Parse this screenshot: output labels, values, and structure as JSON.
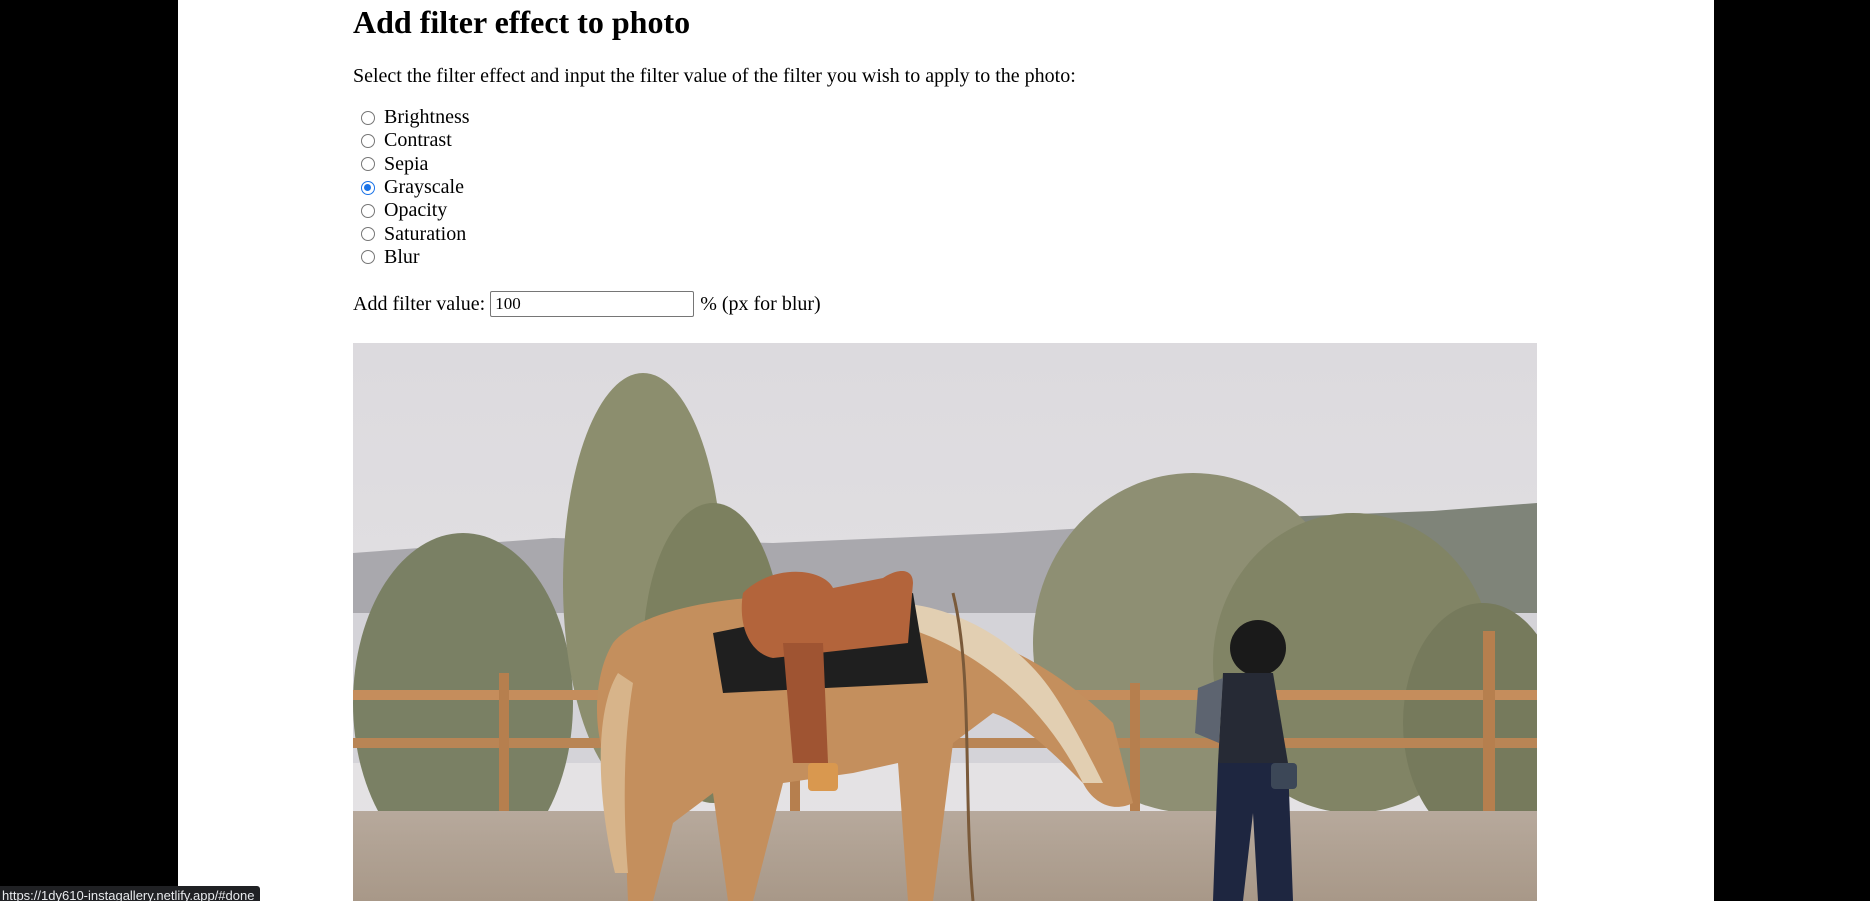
{
  "page": {
    "title": "Add filter effect to photo",
    "instruction": "Select the filter effect and input the filter value of the filter you wish to apply to the photo:"
  },
  "filters": {
    "options": [
      {
        "label": "Brightness",
        "checked": false
      },
      {
        "label": "Contrast",
        "checked": false
      },
      {
        "label": "Sepia",
        "checked": false
      },
      {
        "label": "Grayscale",
        "checked": true
      },
      {
        "label": "Opacity",
        "checked": false
      },
      {
        "label": "Saturation",
        "checked": false
      },
      {
        "label": "Blur",
        "checked": false
      }
    ],
    "selected": "Grayscale"
  },
  "filter_value": {
    "label": "Add filter value:",
    "value": "100",
    "unit_text": "% (px for blur)"
  },
  "photo": {
    "icon": "photo-image"
  },
  "status_bar": {
    "url": "https://1dy610-instagallery.netlify.app/#done"
  },
  "colors": {
    "radio_checked": "#1a73e8",
    "background_outer": "#000000",
    "page_background": "#ffffff"
  }
}
